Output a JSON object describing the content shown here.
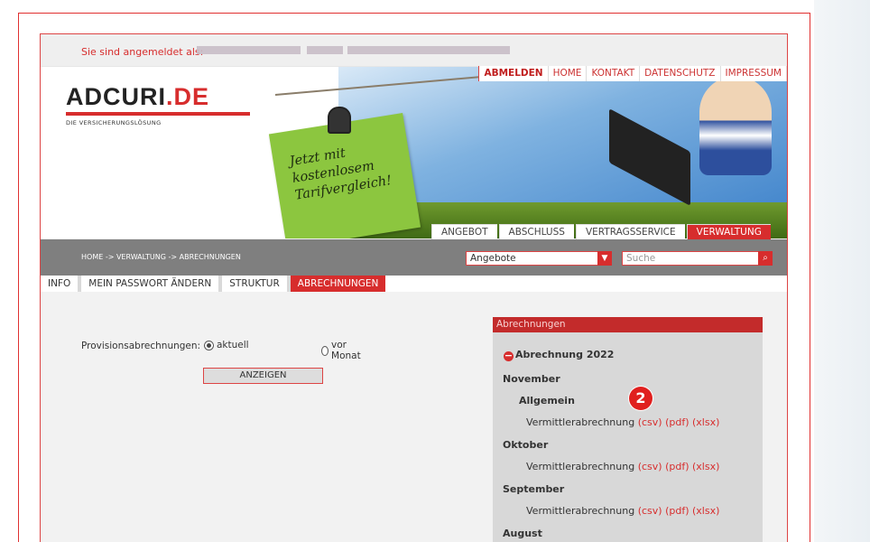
{
  "login": {
    "label": "Sie sind angemeldet als:"
  },
  "topnav": {
    "items": [
      "ABMELDEN",
      "HOME",
      "KONTAKT",
      "DATENSCHUTZ",
      "IMPRESSUM"
    ]
  },
  "logo": {
    "main": "ADCURI",
    "tld": ".DE",
    "tagline": "DIE VERSICHERUNGSLÖSUNG"
  },
  "note": {
    "text": "Jetzt mit\nkostenlosem\nTarifvergleich!"
  },
  "mainnav": {
    "items": [
      "ANGEBOT",
      "ABSCHLUSS",
      "VERTRAGSSERVICE",
      "VERWALTUNG"
    ],
    "active": "VERWALTUNG"
  },
  "breadcrumb": "HOME -> VERWALTUNG -> ABRECHNUNGEN",
  "select": {
    "value": "Angebote"
  },
  "search": {
    "placeholder": "Suche"
  },
  "subnav": {
    "items": [
      "INFO",
      "MEIN PASSWORT ÄNDERN",
      "STRUKTUR",
      "ABRECHNUNGEN"
    ],
    "active": "ABRECHNUNGEN"
  },
  "form": {
    "label": "Provisionsabrechnungen:",
    "option_current": "aktuell",
    "option_prev": "vor Monat",
    "button": "ANZEIGEN"
  },
  "panel": {
    "title": "Abrechnungen",
    "year": "Abrechnung 2022",
    "doc_label": "Vermittlerabrechnung",
    "links": [
      "(csv)",
      "(pdf)",
      "(xlsx)"
    ],
    "months": [
      "November",
      "Oktober",
      "September",
      "August"
    ],
    "section": "Allgemein"
  },
  "badge": "2",
  "colors": {
    "accent": "#d72d2d",
    "navbar": "#7f7f7f",
    "note": "#8cc63f"
  }
}
